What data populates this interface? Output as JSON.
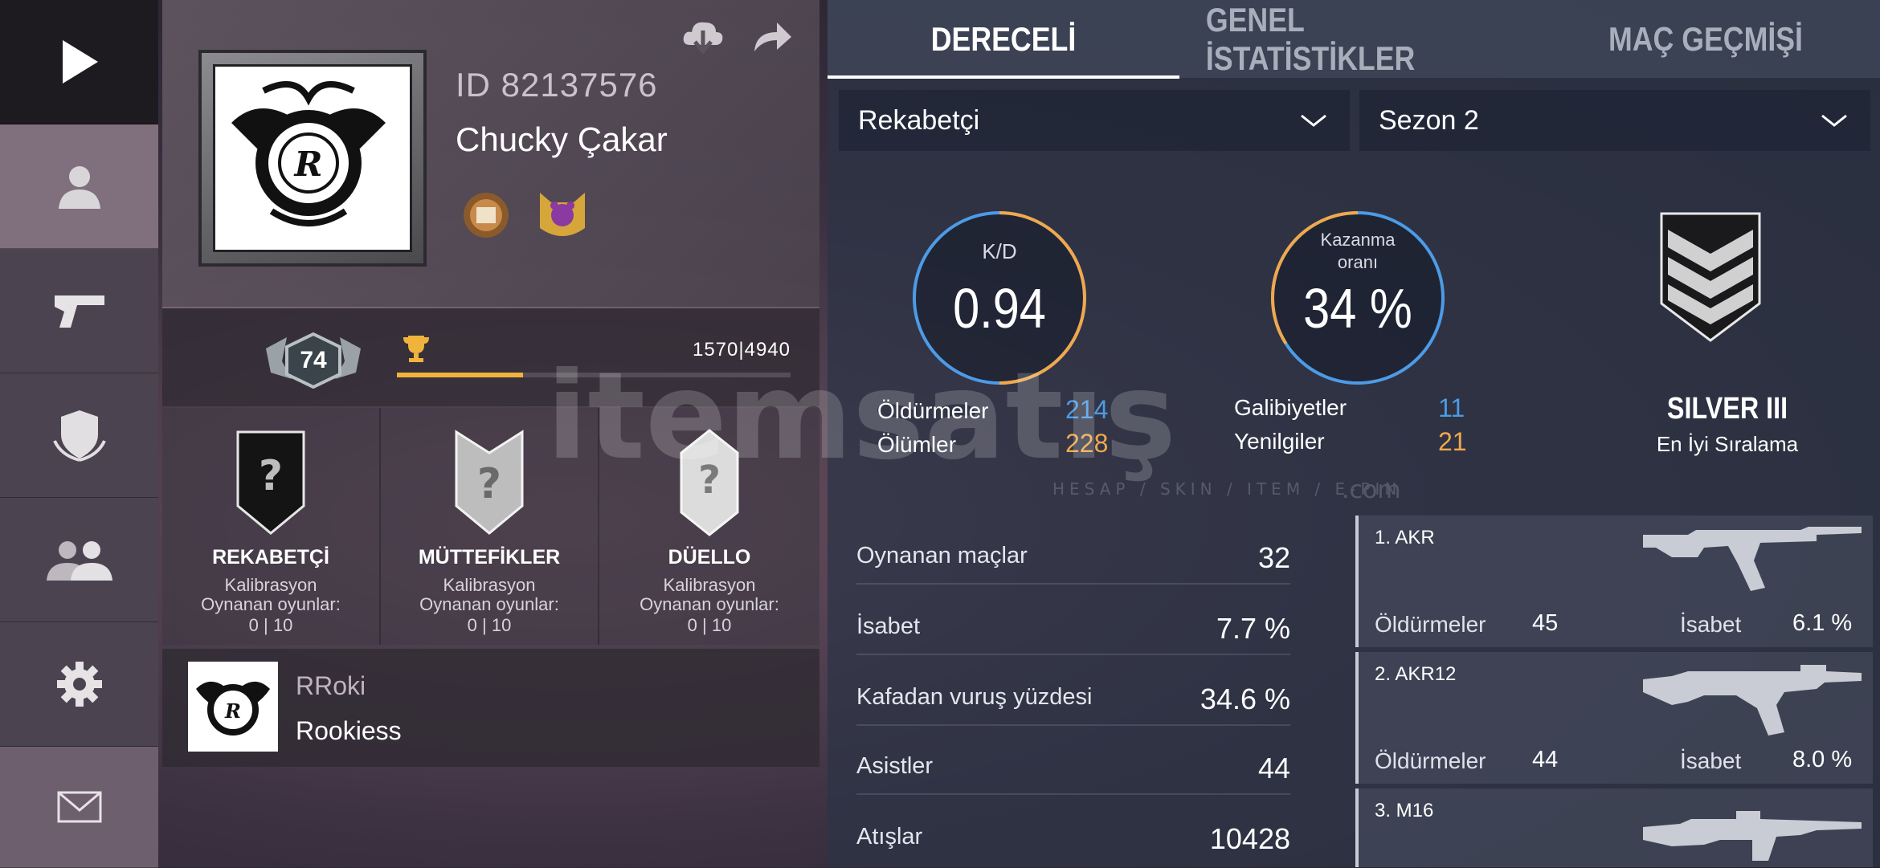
{
  "nav": {
    "items": [
      {
        "name": "play",
        "icon": "play-icon"
      },
      {
        "name": "profile",
        "icon": "user-icon"
      },
      {
        "name": "weapons",
        "icon": "pistol-icon"
      },
      {
        "name": "clan",
        "icon": "shield-icon"
      },
      {
        "name": "friends",
        "icon": "friends-icon"
      },
      {
        "name": "settings",
        "icon": "gear-icon"
      },
      {
        "name": "messages",
        "icon": "mail-icon"
      }
    ]
  },
  "profile": {
    "id": "ID 82137576",
    "name": "Chucky Çakar",
    "level": "74",
    "xp": "1570|4940",
    "xp_progress": 0.32,
    "modes": [
      {
        "title": "REKABETÇİ",
        "line1": "Kalibrasyon",
        "line2": "Oynanan oyunlar:",
        "line3": "0 | 10"
      },
      {
        "title": "MÜTTEFİKLER",
        "line1": "Kalibrasyon",
        "line2": "Oynanan oyunlar:",
        "line3": "0 | 10"
      },
      {
        "title": "DÜELLO",
        "line1": "Kalibrasyon",
        "line2": "Oynanan oyunlar:",
        "line3": "0 | 10"
      }
    ],
    "clan": {
      "tag": "RRoki",
      "name": "Rookiess"
    }
  },
  "tabs": [
    "DERECELİ",
    "GENEL İSTATİSTİKLER",
    "MAÇ GEÇMİŞİ"
  ],
  "filters": {
    "mode": "Rekabetçi",
    "season": "Sezon 2"
  },
  "summary": {
    "kd_label": "K/D",
    "kd_value": "0.94",
    "winrate_label1": "Kazanma",
    "winrate_label2": "oranı",
    "winrate_value": "34 %",
    "winrate_fraction": 0.34,
    "kills_label": "Öldürmeler",
    "kills": "214",
    "deaths_label": "Ölümler",
    "deaths": "228",
    "wins_label": "Galibiyetler",
    "wins": "11",
    "losses_label": "Yenilgiler",
    "losses": "21",
    "rank": "SILVER III",
    "rank_sub": "En İyi Sıralama"
  },
  "table": [
    {
      "label": "Oynanan maçlar",
      "value": "32"
    },
    {
      "label": "İsabet",
      "value": "7.7 %"
    },
    {
      "label": "Kafadan vuruş yüzdesi",
      "value": "34.6 %"
    },
    {
      "label": "Asistler",
      "value": "44"
    },
    {
      "label": "Atışlar",
      "value": "10428"
    }
  ],
  "weapons": [
    {
      "name": "1. AKR",
      "kills_label": "Öldürmeler",
      "kills": "45",
      "acc_label": "İsabet",
      "acc": "6.1 %"
    },
    {
      "name": "2. AKR12",
      "kills_label": "Öldürmeler",
      "kills": "44",
      "acc_label": "İsabet",
      "acc": "8.0 %"
    },
    {
      "name": "3. M16",
      "kills_label": "",
      "kills": "",
      "acc_label": "",
      "acc": ""
    }
  ],
  "watermark": {
    "brand": "itemsatış",
    "tagline": "HESAP / SKIN / ITEM / E-PIN",
    "domain": ".com"
  },
  "colors": {
    "accent_orange": "#f0a84c",
    "accent_blue": "#4d9be6",
    "progress": "#f0b43c"
  }
}
